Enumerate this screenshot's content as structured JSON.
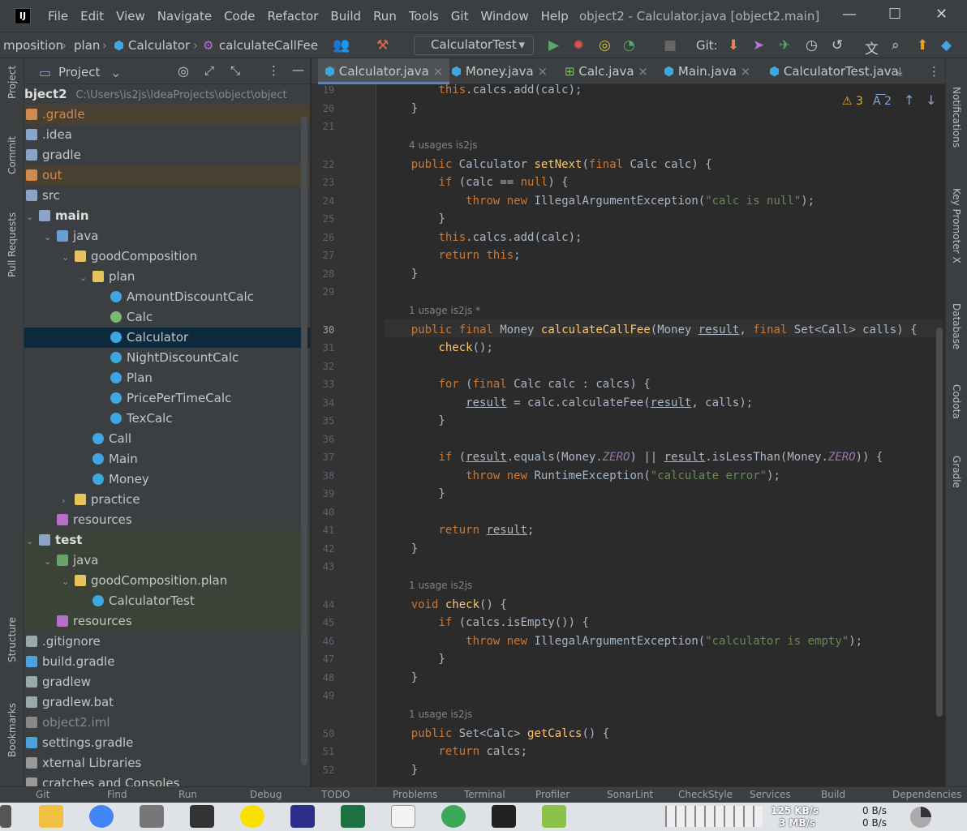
{
  "window": {
    "title": "object2 - Calculator.java [object2.main]",
    "menus": [
      "File",
      "Edit",
      "View",
      "Navigate",
      "Code",
      "Refactor",
      "Build",
      "Run",
      "Tools",
      "Git",
      "Window",
      "Help"
    ]
  },
  "navbar": {
    "breadcrumb": [
      "mposition",
      "plan",
      "Calculator",
      "calculateCallFee"
    ],
    "run_config": "CalculatorTest",
    "git_label": "Git:"
  },
  "project": {
    "header": "Project",
    "root": "bject2",
    "root_path": "C:\\Users\\is2js\\IdeaProjects\\object\\object",
    "items": [
      {
        "label": ".gradle",
        "depth": 0,
        "kind": "folder-excluded"
      },
      {
        "label": ".idea",
        "depth": 0,
        "kind": "folder"
      },
      {
        "label": "gradle",
        "depth": 0,
        "kind": "folder"
      },
      {
        "label": "out",
        "depth": 0,
        "kind": "folder-excluded"
      },
      {
        "label": "src",
        "depth": 0,
        "kind": "folder"
      },
      {
        "label": "main",
        "depth": 1,
        "kind": "module",
        "open": true
      },
      {
        "label": "java",
        "depth": 2,
        "kind": "source",
        "open": true
      },
      {
        "label": "goodComposition",
        "depth": 3,
        "kind": "package",
        "open": true
      },
      {
        "label": "plan",
        "depth": 4,
        "kind": "package",
        "open": true
      },
      {
        "label": "AmountDiscountCalc",
        "depth": 5,
        "kind": "class"
      },
      {
        "label": "Calc",
        "depth": 5,
        "kind": "interface"
      },
      {
        "label": "Calculator",
        "depth": 5,
        "kind": "class",
        "selected": true
      },
      {
        "label": "NightDiscountCalc",
        "depth": 5,
        "kind": "class"
      },
      {
        "label": "Plan",
        "depth": 5,
        "kind": "class"
      },
      {
        "label": "PricePerTimeCalc",
        "depth": 5,
        "kind": "class"
      },
      {
        "label": "TexCalc",
        "depth": 5,
        "kind": "class"
      },
      {
        "label": "Call",
        "depth": 4,
        "kind": "class"
      },
      {
        "label": "Main",
        "depth": 4,
        "kind": "class"
      },
      {
        "label": "Money",
        "depth": 4,
        "kind": "class"
      },
      {
        "label": "practice",
        "depth": 3,
        "kind": "package",
        "closed": true
      },
      {
        "label": "resources",
        "depth": 2,
        "kind": "resources"
      },
      {
        "label": "test",
        "depth": 1,
        "kind": "module",
        "open": true
      },
      {
        "label": "java",
        "depth": 2,
        "kind": "test-source",
        "open": true
      },
      {
        "label": "goodComposition.plan",
        "depth": 3,
        "kind": "package",
        "open": true
      },
      {
        "label": "CalculatorTest",
        "depth": 4,
        "kind": "class"
      },
      {
        "label": "resources",
        "depth": 2,
        "kind": "resources"
      },
      {
        "label": ".gitignore",
        "depth": 0,
        "kind": "file"
      },
      {
        "label": "build.gradle",
        "depth": 0,
        "kind": "gradle"
      },
      {
        "label": "gradlew",
        "depth": 0,
        "kind": "file"
      },
      {
        "label": "gradlew.bat",
        "depth": 0,
        "kind": "file"
      },
      {
        "label": "object2.iml",
        "depth": 0,
        "kind": "file-grey"
      },
      {
        "label": "settings.gradle",
        "depth": 0,
        "kind": "gradle"
      },
      {
        "label": "xternal Libraries",
        "depth": 0,
        "kind": "lib"
      },
      {
        "label": "cratches and Consoles",
        "depth": 0,
        "kind": "lib"
      }
    ]
  },
  "tabs": [
    {
      "label": "Calculator.java",
      "active": true
    },
    {
      "label": "Money.java"
    },
    {
      "label": "Calc.java"
    },
    {
      "label": "Main.java"
    },
    {
      "label": "CalculatorTest.java"
    }
  ],
  "editor": {
    "warnings": "3",
    "weak": "2",
    "lines": [
      {
        "n": "19",
        "t": "        this.calcs.add(calc);"
      },
      {
        "n": "20",
        "t": "    }"
      },
      {
        "n": "21",
        "t": ""
      },
      {
        "hint": "4 usages    is2js"
      },
      {
        "n": "22",
        "t": "    public Calculator setNext(final Calc calc) {"
      },
      {
        "n": "23",
        "t": "        if (calc == null) {"
      },
      {
        "n": "24",
        "t": "            throw new IllegalArgumentException(\"calc is null\");"
      },
      {
        "n": "25",
        "t": "        }"
      },
      {
        "n": "26",
        "t": "        this.calcs.add(calc);"
      },
      {
        "n": "27",
        "t": "        return this;"
      },
      {
        "n": "28",
        "t": "    }"
      },
      {
        "n": "29",
        "t": ""
      },
      {
        "hint": "1 usage    is2js *"
      },
      {
        "n": "30",
        "t": "    public final Money calculateCallFee(Money result, final Set<Call> calls) {"
      },
      {
        "n": "31",
        "t": "        check();"
      },
      {
        "n": "32",
        "t": ""
      },
      {
        "n": "33",
        "t": "        for (final Calc calc : calcs) {"
      },
      {
        "n": "34",
        "t": "            result = calc.calculateFee(result, calls);"
      },
      {
        "n": "35",
        "t": "        }"
      },
      {
        "n": "36",
        "t": ""
      },
      {
        "n": "37",
        "t": "        if (result.equals(Money.ZERO) || result.isLessThan(Money.ZERO)) {"
      },
      {
        "n": "38",
        "t": "            throw new RuntimeException(\"calculate error\");"
      },
      {
        "n": "39",
        "t": "        }"
      },
      {
        "n": "40",
        "t": ""
      },
      {
        "n": "41",
        "t": "        return result;"
      },
      {
        "n": "42",
        "t": "    }"
      },
      {
        "n": "43",
        "t": ""
      },
      {
        "hint": "1 usage    is2js"
      },
      {
        "n": "44",
        "t": "    void check() {"
      },
      {
        "n": "45",
        "t": "        if (calcs.isEmpty()) {"
      },
      {
        "n": "46",
        "t": "            throw new IllegalArgumentException(\"calculator is empty\");"
      },
      {
        "n": "47",
        "t": "        }"
      },
      {
        "n": "48",
        "t": "    }"
      },
      {
        "n": "49",
        "t": ""
      },
      {
        "hint": "1 usage    is2js"
      },
      {
        "n": "50",
        "t": "    public Set<Calc> getCalcs() {"
      },
      {
        "n": "51",
        "t": "        return calcs;"
      },
      {
        "n": "52",
        "t": "    }"
      }
    ]
  },
  "sidebar_left": [
    "Project",
    "Commit",
    "Pull Requests",
    "Structure",
    "Bookmarks"
  ],
  "sidebar_right": [
    "Notifications",
    "Key Promoter X",
    "Database",
    "Codota",
    "Gradle"
  ],
  "bottom_tools": [
    "Git",
    "Find",
    "Run",
    "Debug",
    "TODO",
    "Problems",
    "Terminal",
    "Profiler",
    "SonarLint",
    "CheckStyle",
    "Services",
    "Build",
    "Dependencies"
  ],
  "taskbar": {
    "net_up": "125 KB/s",
    "net_down": "3 MB/s",
    "disk_r": "0 B/s",
    "disk_w": "0 B/s"
  },
  "colors": {
    "bg": "#2b2b2b",
    "panel": "#3c3f41",
    "selected": "#0d293e",
    "keyword": "#cc7832",
    "function": "#ffc66d",
    "string": "#6a8759"
  }
}
